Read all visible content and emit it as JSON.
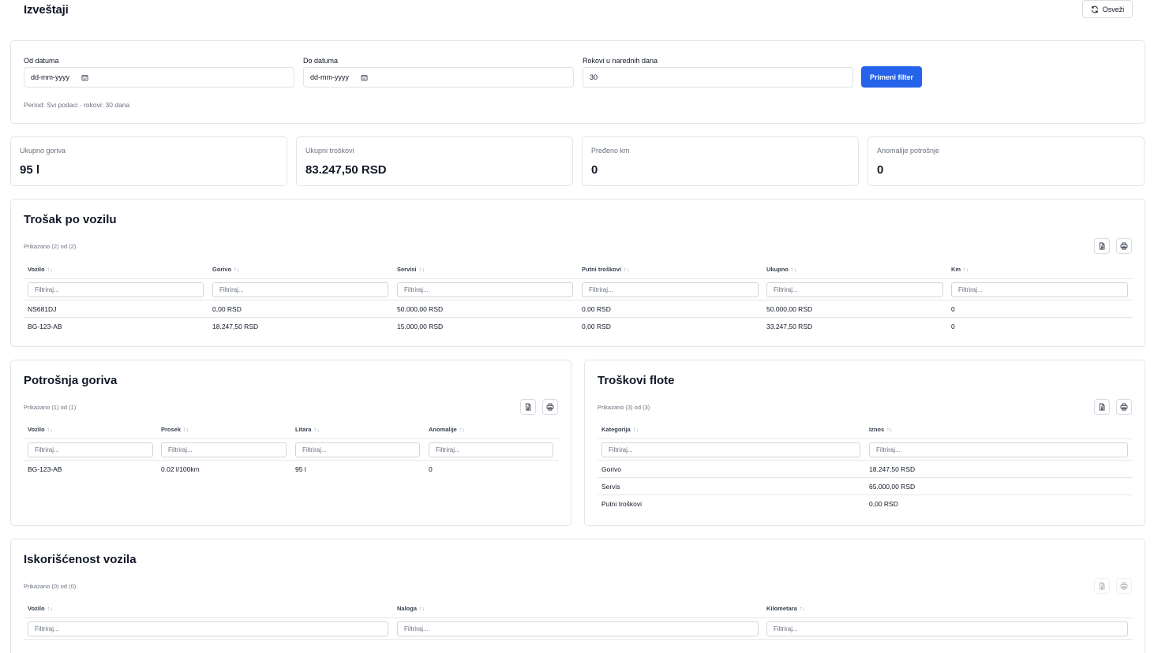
{
  "header": {
    "title": "Izveštaji",
    "refresh_label": "Osveži"
  },
  "filters": {
    "from_label": "Od datuma",
    "from_placeholder": "dd-mm-yyyy",
    "to_label": "Do datuma",
    "to_placeholder": "dd-mm-yyyy",
    "deadlines_label": "Rokovi u narednih dana",
    "deadlines_value": "30",
    "apply_label": "Primeni filter",
    "period_text": "Period: Svi podaci · rokovi: 30 dana"
  },
  "stats": [
    {
      "label": "Ukupno goriva",
      "value": "95 l"
    },
    {
      "label": "Ukupni troškovi",
      "value": "83.247,50 RSD"
    },
    {
      "label": "Pređeno km",
      "value": "0"
    },
    {
      "label": "Anomalije potrošnje",
      "value": "0"
    }
  ],
  "filter_placeholder": "Filtriraj...",
  "sort_glyph": "↑↓",
  "vehicle_cost": {
    "title": "Trošak po vozilu",
    "shown": "Prikazano (2) od (2)",
    "columns": [
      "Vozilo",
      "Gorivo",
      "Servisi",
      "Putni troškovi",
      "Ukupno",
      "Km"
    ],
    "rows": [
      [
        "NS681DJ",
        "0,00 RSD",
        "50.000,00 RSD",
        "0,00 RSD",
        "50.000,00 RSD",
        "0"
      ],
      [
        "BG-123-AB",
        "18.247,50 RSD",
        "15.000,00 RSD",
        "0,00 RSD",
        "33.247,50 RSD",
        "0"
      ]
    ]
  },
  "fuel": {
    "title": "Potrošnja goriva",
    "shown": "Prikazano (1) od (1)",
    "columns": [
      "Vozilo",
      "Prosek",
      "Litara",
      "Anomalije"
    ],
    "rows": [
      [
        "BG-123-AB",
        "0.02 l/100km",
        "95 l",
        "0"
      ]
    ]
  },
  "fleet_costs": {
    "title": "Troškovi flote",
    "shown": "Prikazano (3) od (3)",
    "columns": [
      "Kategorija",
      "Iznos"
    ],
    "rows": [
      [
        "Gorivo",
        "18.247,50 RSD"
      ],
      [
        "Servis",
        "65.000,00 RSD"
      ],
      [
        "Putni troškovi",
        "0,00 RSD"
      ]
    ]
  },
  "utilization": {
    "title": "Iskorišćenost vozila",
    "shown": "Prikazano (0) od (0)",
    "columns": [
      "Vozilo",
      "Naloga",
      "Kilometara"
    ],
    "rows": []
  }
}
